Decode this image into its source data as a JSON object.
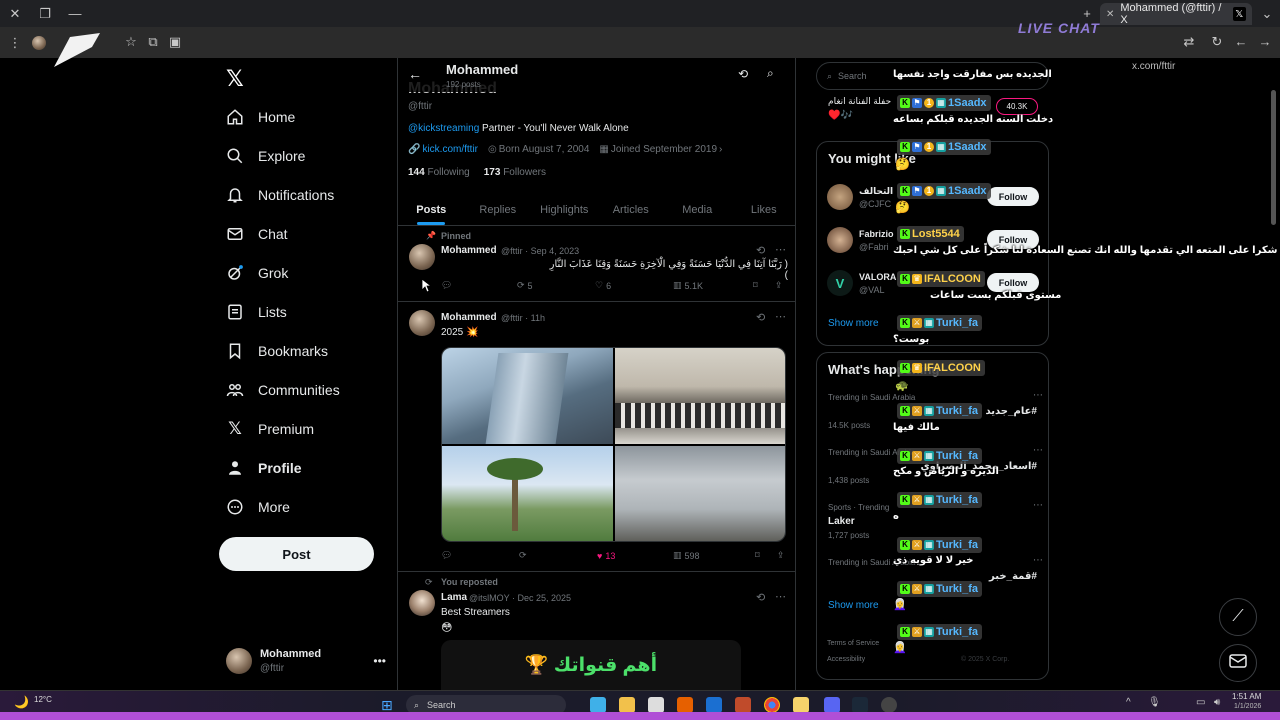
{
  "browser": {
    "tab_title": "Mohammed (@fttir) / X",
    "url": "x.com/fttir",
    "overlay_brand": "LIVE CHAT"
  },
  "nav": {
    "items": [
      {
        "label": "Home",
        "icon": "home-icon"
      },
      {
        "label": "Explore",
        "icon": "search-icon"
      },
      {
        "label": "Notifications",
        "icon": "bell-icon"
      },
      {
        "label": "Chat",
        "icon": "mail-icon"
      },
      {
        "label": "Grok",
        "icon": "grok-icon"
      },
      {
        "label": "Lists",
        "icon": "list-icon"
      },
      {
        "label": "Bookmarks",
        "icon": "bookmark-icon"
      },
      {
        "label": "Communities",
        "icon": "people-icon"
      },
      {
        "label": "Premium",
        "icon": "x-icon"
      },
      {
        "label": "Profile",
        "icon": "person-icon"
      },
      {
        "label": "More",
        "icon": "more-circle-icon"
      }
    ],
    "post_label": "Post",
    "account_name": "Mohammed",
    "account_handle": "@fttir"
  },
  "profile": {
    "name": "Mohammed",
    "posts_count": "192 posts",
    "handle": "@fttir",
    "bio_mention": "@kickstreaming",
    "bio_text": " Partner - You'll Never Walk Alone",
    "link": "kick.com/fttir",
    "born": "Born August 7, 2004",
    "joined": "Joined September 2019",
    "following_count": "144",
    "following_label": "Following",
    "followers_count": "173",
    "followers_label": "Followers",
    "tabs": [
      "Posts",
      "Replies",
      "Highlights",
      "Articles",
      "Media",
      "Likes"
    ]
  },
  "posts": [
    {
      "pinned_label": "Pinned",
      "name": "Mohammed",
      "meta": "@fttir · Sep 4, 2023",
      "text": "( رَبَّنَا آتِنَا فِي الدُّنْيَا حَسَنَةً وَفِي الْآخِرَةِ حَسَنَةً وَقِنَا عَذَابَ النَّارِ )",
      "replies": "",
      "reposts": "5",
      "likes": "6",
      "views": "5.1K"
    },
    {
      "name": "Mohammed",
      "meta": "@fttir · 11h",
      "text": "2025 💥",
      "replies": "",
      "reposts": "",
      "likes": "13",
      "views": "598"
    },
    {
      "repost_label": "You reposted",
      "name": "Lama",
      "meta": "@itslMOY · Dec 25, 2025",
      "text": "Best Streamers",
      "emoji": "😳",
      "banner_text": "أهم قنواتك 🏆"
    }
  ],
  "right": {
    "search_placeholder": "Search",
    "live_label": "حفلة الفنانة انغام",
    "live_emoji": "♥️🎶",
    "live_count": "40.3K",
    "wtf_title": "You might like",
    "suggestions": [
      {
        "name": "التحالف",
        "handle": "@CJFC"
      },
      {
        "name": "Fabrizio",
        "handle": "@Fabri"
      },
      {
        "name": "VALORA",
        "handle": "@VAL"
      }
    ],
    "follow_label": "Follow",
    "show_more": "Show more",
    "happening_title": "What's happening",
    "trends": [
      {
        "context": "Trending in Saudi Arabia",
        "topic": "#عام_جديد",
        "posts": "14.5K posts"
      },
      {
        "context": "Trending in Saudi Arabia",
        "topic": "#اسعاد_محمد_البصراوي",
        "posts": "1,438 posts"
      },
      {
        "context": "Sports · Trending",
        "topic": "Laker",
        "posts": "1,727 posts"
      },
      {
        "context": "Trending in Saudi Arabia",
        "topic": "#قمة_خبر",
        "posts": ""
      }
    ],
    "footer1": "Terms of Service",
    "footer2": "Accessibility",
    "footer3": "© 2025 X Corp."
  },
  "chat": [
    {
      "type": "msg",
      "text": "الجديده بس مفارقت واجد نفسها"
    },
    {
      "type": "user",
      "name": "1Saadx",
      "color": "#55b8ff"
    },
    {
      "type": "msg",
      "text": "دخلت السنه الجديده قبلكم بساعه"
    },
    {
      "type": "user",
      "name": "1Saadx",
      "color": "#55b8ff"
    },
    {
      "type": "msg",
      "text": "🤔"
    },
    {
      "type": "user",
      "name": "1Saadx",
      "color": "#55b8ff"
    },
    {
      "type": "msg",
      "text": "🤔"
    },
    {
      "type": "user",
      "name": "Lost5544",
      "color": "#ffd24a"
    },
    {
      "type": "msg",
      "text": "شكرا على المتعه الي تقدمها والله انك تصنع السعادة لنا شكراً على كل شي احبك"
    },
    {
      "type": "user",
      "name": "IFALCOON",
      "color": "#ffd24a"
    },
    {
      "type": "msg",
      "text": "مستوى قبلكم بست ساعات"
    },
    {
      "type": "user",
      "name": "Turki_fa",
      "color": "#55b8ff"
    },
    {
      "type": "msg",
      "text": "بوست؟"
    },
    {
      "type": "user",
      "name": "IFALCOON",
      "color": "#ffd24a"
    },
    {
      "type": "user",
      "name": "Turki_fa",
      "color": "#55b8ff"
    },
    {
      "type": "msg",
      "text": "مالك فيها"
    },
    {
      "type": "user",
      "name": "Turki_fa",
      "color": "#55b8ff"
    },
    {
      "type": "msg",
      "text": "الديره و الرياض و مكح"
    },
    {
      "type": "user",
      "name": "Turki_fa",
      "color": "#55b8ff"
    },
    {
      "type": "msg",
      "text": "ه"
    },
    {
      "type": "user",
      "name": "Turki_fa",
      "color": "#55b8ff"
    },
    {
      "type": "msg",
      "text": "خير لا لا قويه ذي"
    },
    {
      "type": "user",
      "name": "Turki_fa",
      "color": "#55b8ff"
    },
    {
      "type": "user",
      "name": "Turki_fa",
      "color": "#55b8ff"
    }
  ],
  "taskbar": {
    "weather": "12°C",
    "search": "Search",
    "time": "1:51 AM",
    "date": "1/1/2026"
  },
  "colors": {
    "accent": "#1d9bf0",
    "like": "#f91880",
    "taskbar_edge": "#b04fd6"
  }
}
